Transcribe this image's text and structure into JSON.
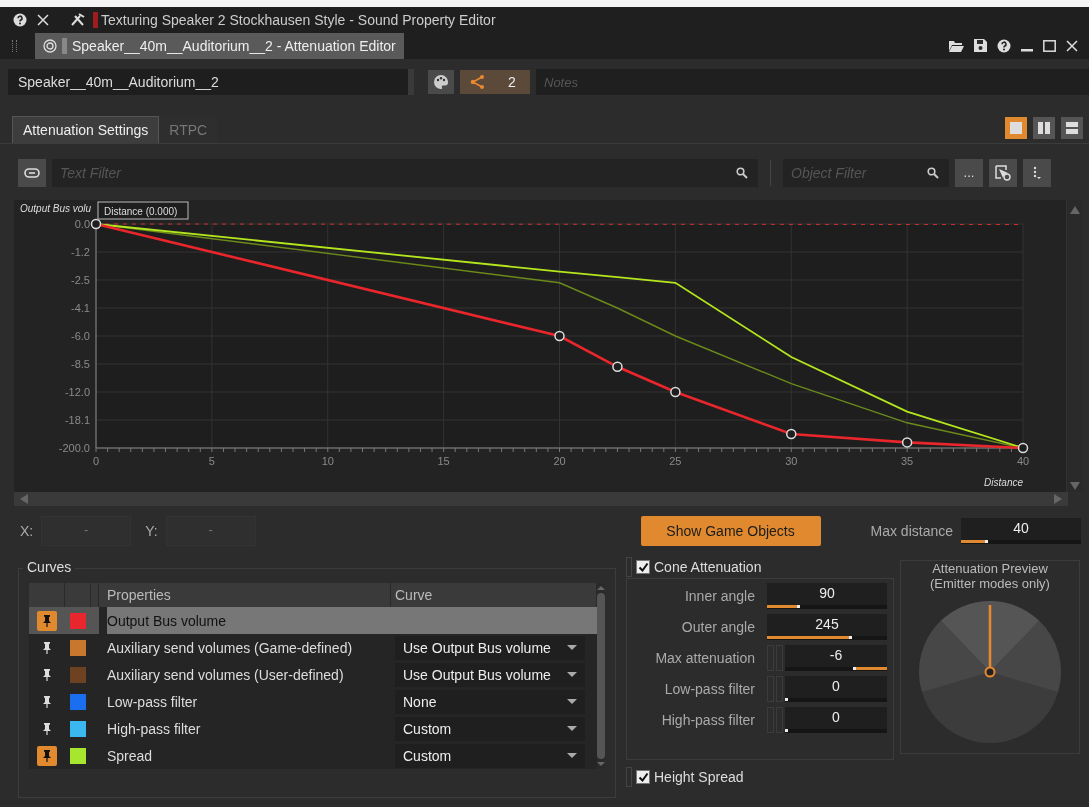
{
  "window": {
    "title": "Texturing Speaker 2  Stockhausen Style - Sound Property Editor"
  },
  "editor_tab": {
    "title": "Speaker__40m__Auditorium__2 - Attenuation Editor"
  },
  "header": {
    "name": "Speaker__40m__Auditorium__2",
    "share_count": "2",
    "notes_placeholder": "Notes"
  },
  "tabs": [
    {
      "label": "Attenuation Settings",
      "selected": true
    },
    {
      "label": "RTPC",
      "selected": false
    }
  ],
  "layout_buttons": [
    {
      "kind": "single",
      "selected": true
    },
    {
      "kind": "columns",
      "selected": false
    },
    {
      "kind": "rows",
      "selected": false
    }
  ],
  "filters": {
    "text_placeholder": "Text Filter",
    "object_placeholder": "Object Filter",
    "more": "..."
  },
  "graph": {
    "tooltip": "Distance (0.000)",
    "y_title": "Output Bus volu",
    "x_title": "Distance",
    "y_labels": [
      "0.0",
      "-1.2",
      "-2.5",
      "-4.1",
      "-6.0",
      "-8.5",
      "-12.0",
      "-18.1",
      "-200.0"
    ],
    "x_labels": [
      "0",
      "5",
      "10",
      "15",
      "20",
      "25",
      "30",
      "35",
      "40"
    ]
  },
  "coordinates": {
    "x_label": "X:",
    "x_value": "-",
    "y_label": "Y:",
    "y_value": "-"
  },
  "show_game_objects": "Show Game Objects",
  "max_distance": {
    "label": "Max distance",
    "value": "40",
    "level": 0.2
  },
  "curves": {
    "title": "Curves",
    "columns": [
      "Properties",
      "Curve"
    ],
    "rows": [
      {
        "pinned": true,
        "color": "#e8262b",
        "property": "Output Bus volume",
        "selected": true
      },
      {
        "pinned": false,
        "color": "#c8782c",
        "property": "Auxiliary send volumes (Game-defined)",
        "curve": "Use Output Bus volume",
        "selected": false
      },
      {
        "pinned": false,
        "color": "#6e4220",
        "property": "Auxiliary send volumes (User-defined)",
        "curve": "Use Output Bus volume",
        "selected": false
      },
      {
        "pinned": false,
        "color": "#1a6ef0",
        "property": "Low-pass filter",
        "curve": "None",
        "selected": false
      },
      {
        "pinned": false,
        "color": "#3cb8f0",
        "property": "High-pass filter",
        "curve": "Custom",
        "selected": false
      },
      {
        "pinned": true,
        "color": "#a6e62e",
        "property": "Spread",
        "curve": "Custom",
        "selected": false
      }
    ]
  },
  "cone": {
    "label": "Cone Attenuation",
    "checked": true,
    "rows": [
      {
        "kind": "plain",
        "label": "Inner angle",
        "value": "90",
        "level": 0.25,
        "from_right": false
      },
      {
        "kind": "plain",
        "label": "Outer angle",
        "value": "245",
        "level": 0.68,
        "from_right": false
      },
      {
        "kind": "linked",
        "label": "Max attenuation",
        "value": "-6",
        "level": 0.3,
        "from_right": true
      },
      {
        "kind": "linked",
        "label": "Low-pass filter",
        "value": "0",
        "level": 0,
        "from_right": false
      },
      {
        "kind": "linked",
        "label": "High-pass filter",
        "value": "0",
        "level": 0,
        "from_right": false
      }
    ]
  },
  "preview": {
    "title": "Attenuation Preview",
    "subtitle": "(Emitter modes only)"
  },
  "height_spread": {
    "label": "Height Spread",
    "checked": true
  }
}
